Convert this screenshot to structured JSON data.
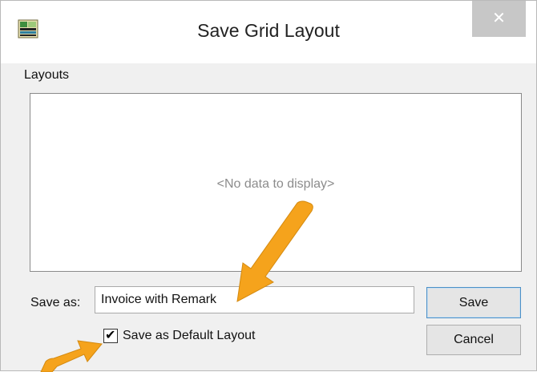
{
  "window": {
    "title": "Save Grid Layout",
    "close_label": "✕",
    "icon": "grid-app-icon"
  },
  "layouts": {
    "label": "Layouts",
    "empty_text": "<No data to display>"
  },
  "save_as": {
    "label": "Save as:",
    "value": "Invoice with Remark"
  },
  "default_layout": {
    "label": "Save as Default Layout",
    "checked": true,
    "check_glyph": "✔"
  },
  "buttons": {
    "save_label": "Save",
    "cancel_label": "Cancel"
  },
  "colors": {
    "annotation_arrow": "#f5a31c"
  }
}
